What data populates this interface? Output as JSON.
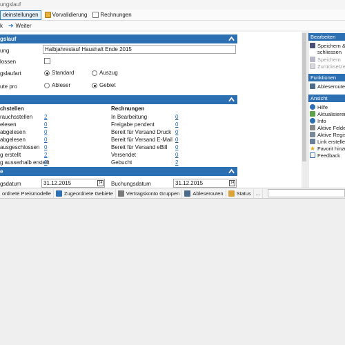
{
  "window": {
    "title": "ungslauf"
  },
  "tabs": [
    {
      "label": "deinstellungen",
      "active": true
    },
    {
      "label": "Vorvalidierung",
      "active": false
    },
    {
      "label": "Rechnungen",
      "active": false
    }
  ],
  "nav": {
    "back_label": "k",
    "forward_label": "Weiter"
  },
  "section1": {
    "title": "gslauf",
    "description_label": "ung",
    "description_value": "Halbjahreslauf Haushalt Ende 2015",
    "closed_label": "lossen",
    "run_type_label": "gslaufart",
    "run_type_options": [
      "Standard",
      "Auszug"
    ],
    "run_type_selected": "Standard",
    "route_label": "ute pro",
    "route_options": [
      "Ableser",
      "Gebiet"
    ],
    "route_selected": "Gebiet"
  },
  "section2": {
    "left_header": "chstellen",
    "left_rows": [
      {
        "label": "rauchsstellen",
        "value": "2"
      },
      {
        "label": "elesen",
        "value": "0"
      },
      {
        "label": "abgelesen",
        "value": "0"
      },
      {
        "label": "abgelesen",
        "value": "0"
      },
      {
        "label": "ausgeschlossen",
        "value": "0"
      },
      {
        "label": "g erstellt",
        "value": "2"
      },
      {
        "label": "g ausserhalb erstellt",
        "value": "0"
      }
    ],
    "right_header": "Rechnungen",
    "right_rows": [
      {
        "label": "In Bearbeitung",
        "value": "0"
      },
      {
        "label": "Freigabe pendent",
        "value": "0"
      },
      {
        "label": "Bereit für Versand Druck",
        "value": "0"
      },
      {
        "label": "Bereit für Versand E-Mail",
        "value": "0"
      },
      {
        "label": "Bereit für Versand eBill",
        "value": "0"
      },
      {
        "label": "Versendet",
        "value": "0"
      },
      {
        "label": "Gebucht",
        "value": "2"
      }
    ]
  },
  "section3": {
    "title": "e",
    "date1_label": "gsdatum",
    "date1_value": "31.12.2015",
    "date2_label": "Buchungsdatum",
    "date2_value": "31.12.2015"
  },
  "right_panel": {
    "groups": [
      {
        "title": "Bearbeiten",
        "items": [
          {
            "label": "Speichern &",
            "icon": "save-icon",
            "disabled": false
          },
          {
            "label": "schliessen",
            "icon": "",
            "disabled": false
          },
          {
            "label": "Speichern",
            "icon": "save-icon",
            "disabled": true
          },
          {
            "label": "Zurücksetzen",
            "icon": "reset-icon",
            "disabled": true
          }
        ]
      },
      {
        "title": "Funktionen",
        "items": [
          {
            "label": "Ableserouten",
            "icon": "route-icon",
            "disabled": false
          }
        ]
      },
      {
        "title": "Ansicht",
        "items": [
          {
            "label": "Hilfe",
            "icon": "help-icon",
            "disabled": false
          },
          {
            "label": "Aktualisieren",
            "icon": "refresh-icon",
            "disabled": false
          },
          {
            "label": "Info",
            "icon": "info-icon",
            "disabled": false
          },
          {
            "label": "Aktive Felder",
            "icon": "fields-icon",
            "disabled": false
          },
          {
            "label": "Aktive Regist",
            "icon": "register-icon",
            "disabled": false
          },
          {
            "label": "Link erstellen",
            "icon": "link-icon",
            "disabled": false
          },
          {
            "label": "Favorit hinzu",
            "icon": "star-icon",
            "disabled": false
          },
          {
            "label": "Feedback",
            "icon": "feedback-icon",
            "disabled": false
          }
        ]
      }
    ]
  },
  "bottom_tabs": [
    {
      "label": "ordnete Preismodelle",
      "icon": ""
    },
    {
      "label": "Zugeordnete Gebiete",
      "icon": "house-icon"
    },
    {
      "label": "Vertragskonto Gruppen",
      "icon": "link-icon"
    },
    {
      "label": "Ableserouten",
      "icon": "route-icon"
    },
    {
      "label": "Status",
      "icon": "status-icon"
    },
    {
      "label": "...",
      "icon": ""
    }
  ],
  "colors": {
    "accent": "#2d6fb3",
    "link": "#1d64b0"
  }
}
